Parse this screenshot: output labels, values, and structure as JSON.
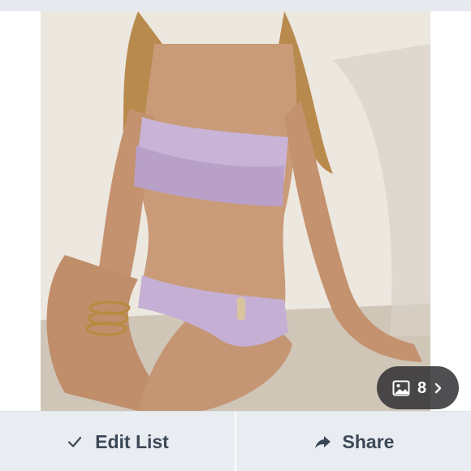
{
  "photo": {
    "alt_icon": "image-icon",
    "count": "8",
    "next_icon": "chevron-right-icon"
  },
  "actions": {
    "edit_list_label": "Edit List",
    "edit_list_icon": "check-icon",
    "share_label": "Share",
    "share_icon": "share-arrow-icon"
  },
  "colors": {
    "background": "#e9edf1",
    "action_text": "#3b4756",
    "pill": "#28282c"
  }
}
